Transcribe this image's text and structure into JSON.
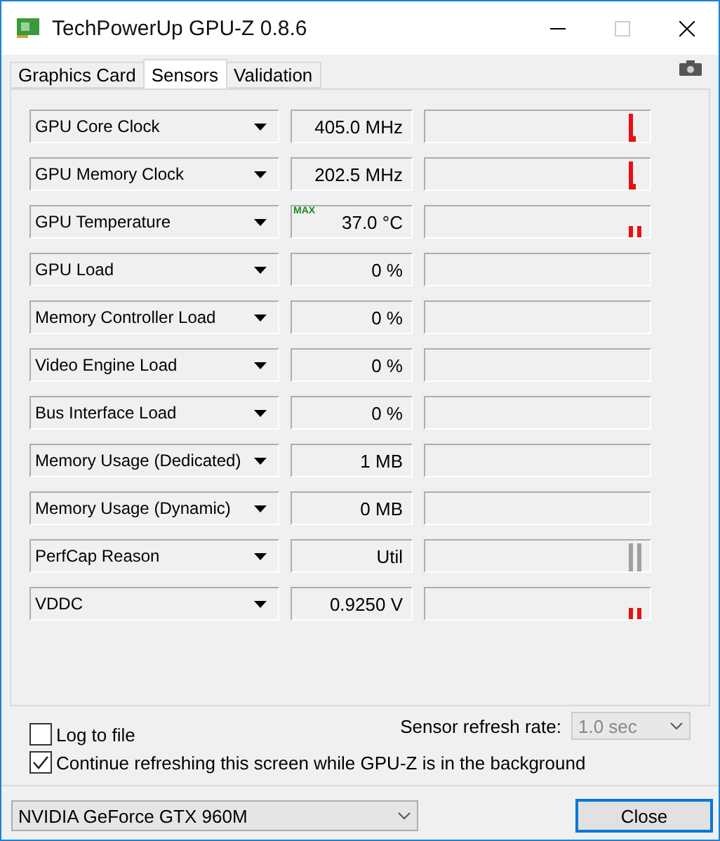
{
  "window": {
    "title": "TechPowerUp GPU-Z 0.8.6"
  },
  "tabs": [
    {
      "label": "Graphics Card",
      "selected": false
    },
    {
      "label": "Sensors",
      "selected": true
    },
    {
      "label": "Validation",
      "selected": false
    }
  ],
  "sensors": [
    {
      "name": "GPU Core Clock",
      "value": "405.0 MHz",
      "kind": "falling",
      "color": "#e81010"
    },
    {
      "name": "GPU Memory Clock",
      "value": "202.5 MHz",
      "kind": "falling",
      "color": "#e81010"
    },
    {
      "name": "GPU Temperature",
      "value": "37.0 °C",
      "max_label": "MAX",
      "kind": "twin",
      "color": "#e81010"
    },
    {
      "name": "GPU Load",
      "value": "0 %",
      "kind": "flat"
    },
    {
      "name": "Memory Controller Load",
      "value": "0 %",
      "kind": "flat"
    },
    {
      "name": "Video Engine Load",
      "value": "0 %",
      "kind": "flat"
    },
    {
      "name": "Bus Interface Load",
      "value": "0 %",
      "kind": "flat"
    },
    {
      "name": "Memory Usage (Dedicated)",
      "value": "1 MB",
      "kind": "flat"
    },
    {
      "name": "Memory Usage (Dynamic)",
      "value": "0 MB",
      "kind": "flat"
    },
    {
      "name": "PerfCap Reason",
      "value": "Util",
      "kind": "tall",
      "color": "#a0a0a0"
    },
    {
      "name": "VDDC",
      "value": "0.9250 V",
      "kind": "twin",
      "color": "#e81010"
    }
  ],
  "options": [
    {
      "label": "Log to file",
      "checked": false
    },
    {
      "label": "Continue refreshing this screen while GPU-Z is in the background",
      "checked": true
    }
  ],
  "refresh": {
    "label": "Sensor refresh rate:",
    "value": "1.0 sec",
    "disabled": true
  },
  "gpu_select": {
    "value": "NVIDIA GeForce GTX 960M"
  },
  "buttons": [
    {
      "label": "Close",
      "focused": true
    }
  ]
}
